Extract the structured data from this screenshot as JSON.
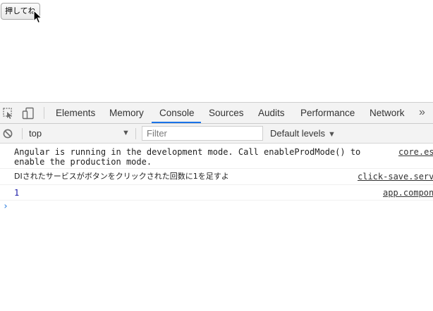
{
  "page": {
    "button_label": "押してね"
  },
  "devtools": {
    "tabs": [
      {
        "label": "Elements",
        "active": false
      },
      {
        "label": "Memory",
        "active": false
      },
      {
        "label": "Console",
        "active": true
      },
      {
        "label": "Sources",
        "active": false
      },
      {
        "label": "Audits",
        "active": false
      },
      {
        "label": "Performance",
        "active": false
      },
      {
        "label": "Network",
        "active": false
      }
    ],
    "more_tabs": "»",
    "accent_color": "#1a73e8"
  },
  "filterbar": {
    "context": "top",
    "filter_placeholder": "Filter",
    "filter_value": "",
    "levels": "Default levels"
  },
  "console": {
    "messages": [
      {
        "text": "Angular is running in the development mode. Call enableProdMode() to\nenable the production mode.",
        "source": "core.es"
      },
      {
        "text": "DIされたサービスがボタンをクリックされた回数に1を足すよ",
        "source": "click-save.serv"
      },
      {
        "text": "1",
        "source": "app.compon"
      }
    ],
    "prompt": "›"
  }
}
